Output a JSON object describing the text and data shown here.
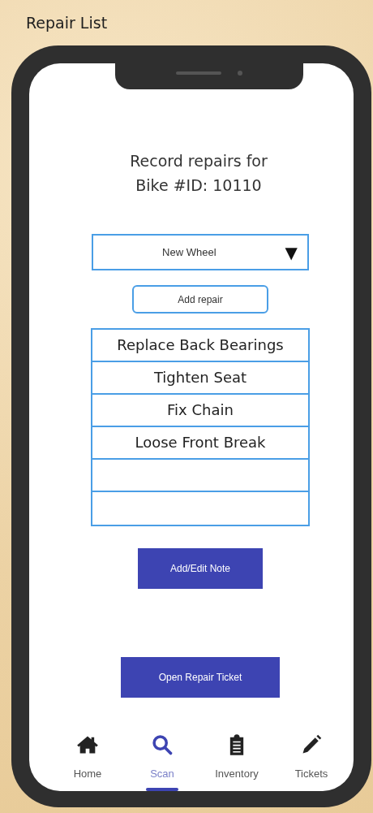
{
  "page_title": "Repair List",
  "heading": [
    "Record repairs for",
    "Bike #ID: 10110"
  ],
  "repair_dropdown": {
    "value": "New Wheel",
    "arrow": "▼"
  },
  "add_button": "Add repair",
  "repairs": [
    "Replace Back Bearings",
    "Tighten Seat",
    "Fix Chain",
    "Loose Front Break"
  ],
  "note_button": "Add/Edit Note",
  "ticket_button": "Open Repair Ticket",
  "nav": [
    {
      "kind": "home",
      "label": "Home",
      "selected": false
    },
    {
      "kind": "search",
      "label": "Scan",
      "selected": true
    },
    {
      "kind": "clipboard",
      "label": "Inventory",
      "selected": false
    },
    {
      "kind": "pencil",
      "label": "Tickets",
      "selected": false
    }
  ]
}
